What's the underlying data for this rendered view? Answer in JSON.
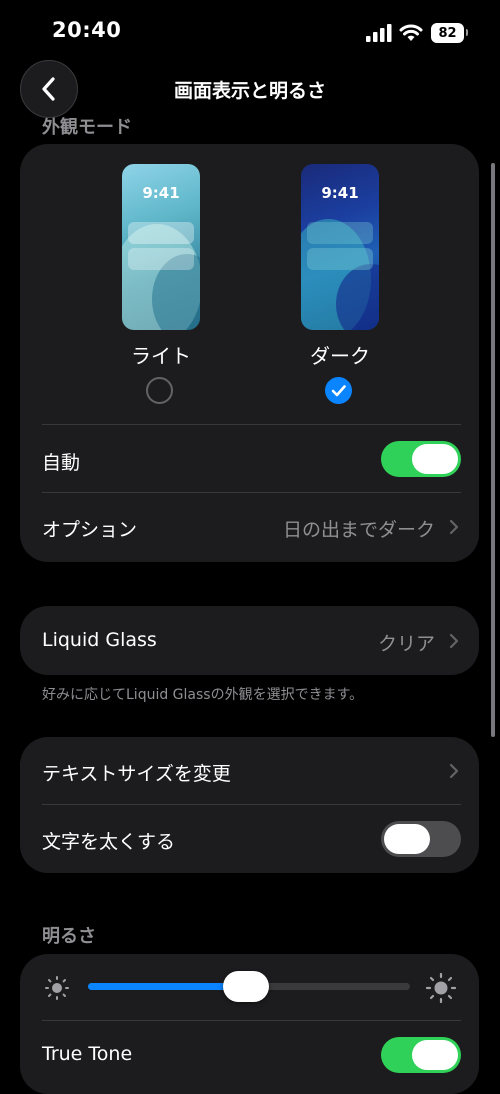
{
  "status_bar": {
    "time": "20:40",
    "battery": "82"
  },
  "nav": {
    "title": "画面表示と明るさ"
  },
  "appearance": {
    "section_title": "外観モード",
    "preview_time": "9:41",
    "light_label": "ライト",
    "dark_label": "ダーク",
    "selected": "dark",
    "auto_label": "自動",
    "auto_on": true,
    "options_label": "オプション",
    "options_value": "日の出までダーク"
  },
  "liquid_glass": {
    "label": "Liquid Glass",
    "value": "クリア",
    "footnote": "好みに応じてLiquid Glassの外観を選択できます。"
  },
  "text": {
    "text_size_label": "テキストサイズを変更",
    "bold_label": "文字を太くする",
    "bold_on": false
  },
  "brightness": {
    "section_title": "明るさ",
    "level": 0.49,
    "true_tone_label": "True Tone",
    "true_tone_on": true
  },
  "colors": {
    "accent": "#0a84ff",
    "toggle_on": "#30d158",
    "card": "#1c1c1e"
  }
}
